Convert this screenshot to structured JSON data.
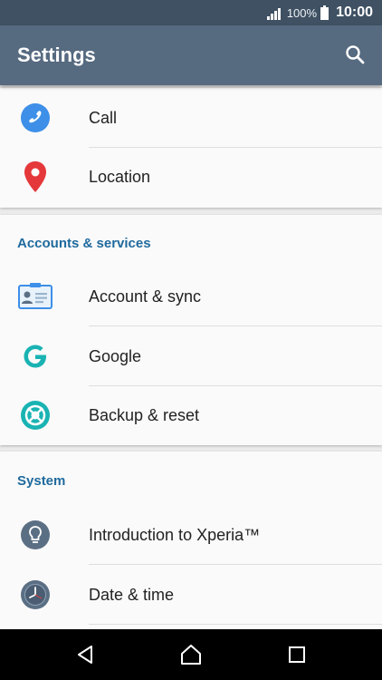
{
  "status_bar": {
    "battery_percent": "100%",
    "time": "10:00"
  },
  "app_bar": {
    "title": "Settings",
    "search_icon": "search-icon"
  },
  "device_items": [
    {
      "label": "Call",
      "icon": "phone-icon",
      "color": "#3d8fe8"
    },
    {
      "label": "Location",
      "icon": "location-pin-icon",
      "color": "#e5383b"
    }
  ],
  "accounts_section": {
    "header": "Accounts & services",
    "items": [
      {
        "label": "Account & sync",
        "icon": "account-card-icon",
        "color": "#3d8fe8"
      },
      {
        "label": "Google",
        "icon": "google-icon",
        "color": "#1ab3b3"
      },
      {
        "label": "Backup & reset",
        "icon": "backup-icon",
        "color": "#1ab3b3"
      }
    ]
  },
  "system_section": {
    "header": "System",
    "items": [
      {
        "label": "Introduction to Xperia™",
        "icon": "lightbulb-icon",
        "color": "#5b6f84"
      },
      {
        "label": "Date & time",
        "icon": "clock-icon",
        "color": "#5b6f84"
      }
    ]
  },
  "nav_bar": {
    "back": "back-icon",
    "home": "home-icon",
    "recents": "recents-icon"
  },
  "colors": {
    "status_bar": "#3f5163",
    "app_bar": "#566a80",
    "section_header": "#1f6a9e",
    "background": "#ececec",
    "card": "#fafafa"
  }
}
